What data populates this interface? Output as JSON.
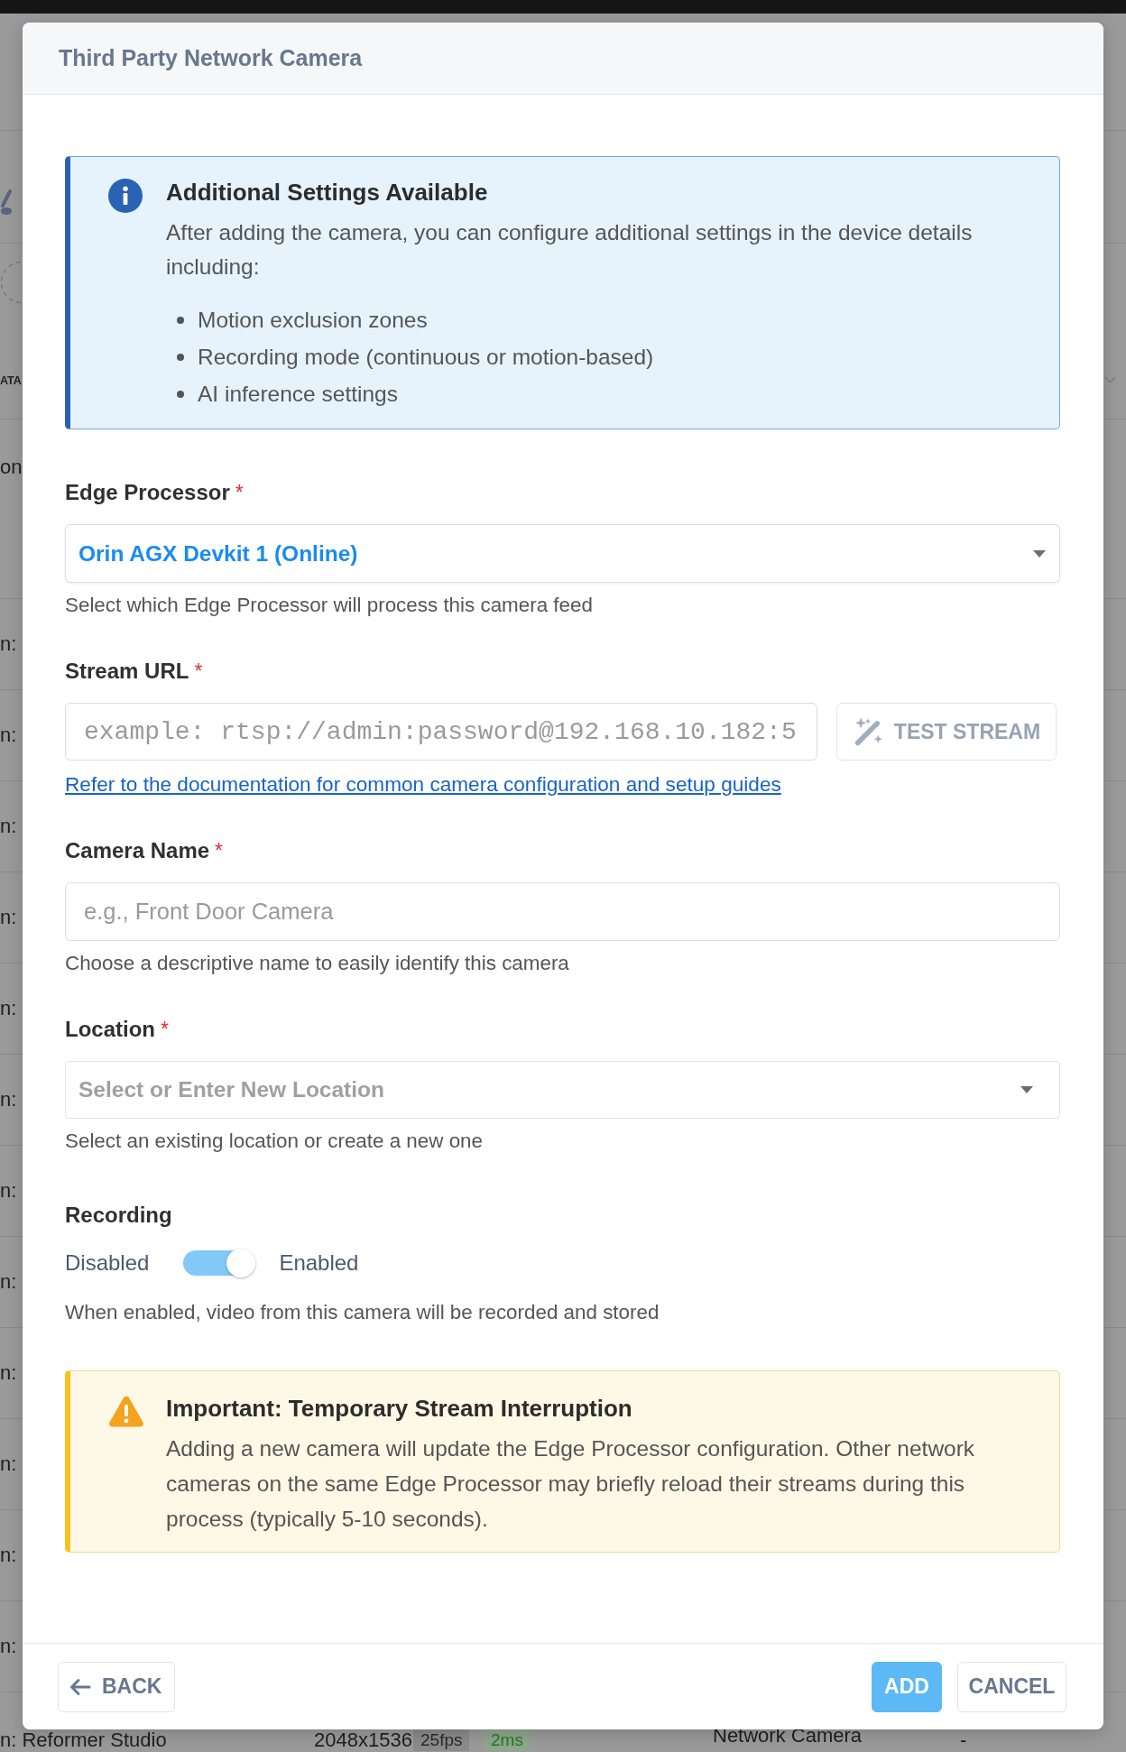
{
  "background_page": {
    "header_fragment": "ATA",
    "rows": [
      {
        "cells": [
          {
            "kind": "text",
            "text": "on"
          }
        ]
      },
      {
        "cells": [
          {
            "kind": "text",
            "text": "n:"
          }
        ]
      },
      {
        "cells": [
          {
            "kind": "text",
            "text": "n:"
          }
        ]
      },
      {
        "cells": [
          {
            "kind": "text",
            "text": "n:"
          }
        ]
      },
      {
        "cells": [
          {
            "kind": "text",
            "text": "n:"
          }
        ]
      },
      {
        "cells": [
          {
            "kind": "text",
            "text": "n:"
          }
        ]
      },
      {
        "cells": [
          {
            "kind": "text",
            "text": "n:"
          }
        ]
      },
      {
        "cells": [
          {
            "kind": "text",
            "text": "n:"
          }
        ]
      },
      {
        "cells": [
          {
            "kind": "text",
            "text": "n:"
          }
        ]
      },
      {
        "cells": [
          {
            "kind": "text",
            "text": "n:"
          }
        ]
      },
      {
        "cells": [
          {
            "kind": "text",
            "text": "n:"
          }
        ]
      },
      {
        "cells": [
          {
            "kind": "text",
            "text": "n:"
          }
        ]
      },
      {
        "cells": [
          {
            "kind": "text",
            "text": "n:"
          }
        ]
      },
      {
        "cells": [
          {
            "kind": "text",
            "text": "n: Reformer Studio"
          },
          {
            "kind": "text",
            "text": "2048x1536"
          },
          {
            "kind": "chip",
            "text": "25fps"
          },
          {
            "kind": "chip-good",
            "text": "2ms"
          },
          {
            "kind": "text",
            "text": "Network Camera"
          },
          {
            "kind": "text",
            "text": "-"
          }
        ]
      }
    ]
  },
  "dialog": {
    "title": "Third Party Network Camera",
    "info": {
      "title": "Additional Settings Available",
      "text": "After adding the camera, you can configure additional settings in the device details including:",
      "items": [
        "Motion exclusion zones",
        "Recording mode (continuous or motion-based)",
        "AI inference settings"
      ]
    },
    "fields": [
      {
        "kind": "select",
        "label": "Edge Processor",
        "required_mark": "*",
        "value": "Orin AGX Devkit 1 (Online)",
        "helper": "Select which Edge Processor will process this camera feed"
      },
      {
        "kind": "stream",
        "label": "Stream URL",
        "required_mark": "*",
        "placeholder": "example: rtsp://admin:password@192.168.10.182:5",
        "button": "TEST STREAM",
        "link": "Refer to the documentation for common camera configuration and setup guides"
      },
      {
        "kind": "text",
        "label": "Camera Name",
        "required_mark": "*",
        "placeholder": "e.g., Front Door Camera",
        "helper": "Choose a descriptive name to easily identify this camera"
      },
      {
        "kind": "combobox",
        "label": "Location",
        "required_mark": "*",
        "placeholder": "Select or Enter New Location",
        "helper": "Select an existing location or create a new one"
      },
      {
        "kind": "toggle",
        "label": "Recording",
        "off_label": "Disabled",
        "on_label": "Enabled",
        "on": true,
        "helper": "When enabled, video from this camera will be recorded and stored"
      }
    ],
    "warning": {
      "title": "Important: Temporary Stream Interruption",
      "text": "Adding a new camera will update the Edge Processor configuration. Other network cameras on the same Edge Processor may briefly reload their streams during this process (typically 5-10 seconds)."
    },
    "footer": {
      "back": "BACK",
      "add": "ADD",
      "cancel": "CANCEL"
    }
  }
}
